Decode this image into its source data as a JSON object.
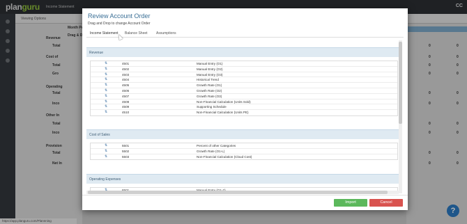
{
  "app": {
    "logo_main": "plan",
    "logo_accent": "guru",
    "top_menu": "Income Statement",
    "top_right": "CC",
    "viewing_options": "Viewing Options",
    "background_rows": [
      "Month Pe",
      "Drag & D",
      "Revenue",
      "Total",
      "Cost of",
      "Total",
      "Gro",
      "Operating",
      "Total",
      "Inco",
      "Other In",
      "Total",
      "Inco",
      "Provision",
      "Total",
      "Net In"
    ],
    "background_value": "0",
    "status_url": "https://app.planguru.com/Plannning",
    "help_label": "?"
  },
  "modal": {
    "title": "Review Account Order",
    "subtitle": "Drag and Drop to change Account Order",
    "tabs": [
      {
        "label": "Income Statement",
        "active": true
      },
      {
        "label": "Balance Sheet",
        "active": false
      },
      {
        "label": "Assumptions",
        "active": false
      }
    ],
    "sections": [
      {
        "name": "Revenue",
        "rows": [
          {
            "code": "4501",
            "method": "Manual Entry (O1)"
          },
          {
            "code": "4502",
            "method": "Manual Entry (O2)"
          },
          {
            "code": "4503",
            "method": "Manual Entry (O3)"
          },
          {
            "code": "4504",
            "method": "Historical Trend"
          },
          {
            "code": "4505",
            "method": "Growth Rate (O1)"
          },
          {
            "code": "4506",
            "method": "Growth Rate (O2)"
          },
          {
            "code": "4507",
            "method": "Growth Rate (O3)"
          },
          {
            "code": "4508",
            "method": "Non-Financial Calculation (Units Sold)"
          },
          {
            "code": "4509",
            "method": "Supporting Schedule"
          },
          {
            "code": "4510",
            "method": "Non-Financial Calculation (Units PE)"
          }
        ]
      },
      {
        "name": "Cost of Sales",
        "rows": [
          {
            "code": "5501",
            "method": "Percent of other Categories"
          },
          {
            "code": "5502",
            "method": "Growth Rate (O1-L)"
          },
          {
            "code": "5503",
            "method": "Non-Financial Calculation (Cloud Cost)"
          }
        ]
      },
      {
        "name": "Operating Expenses",
        "rows": [
          {
            "code": "6501",
            "method": "Manual Entry (O1-2)"
          }
        ]
      }
    ],
    "import_label": "Import",
    "cancel_label": "Cancel"
  },
  "colors": {
    "title": "#3a6f96",
    "section_bg": "#dfeaf2",
    "import": "#5cb85c",
    "cancel": "#d9534f",
    "help": "#2a78c0"
  }
}
